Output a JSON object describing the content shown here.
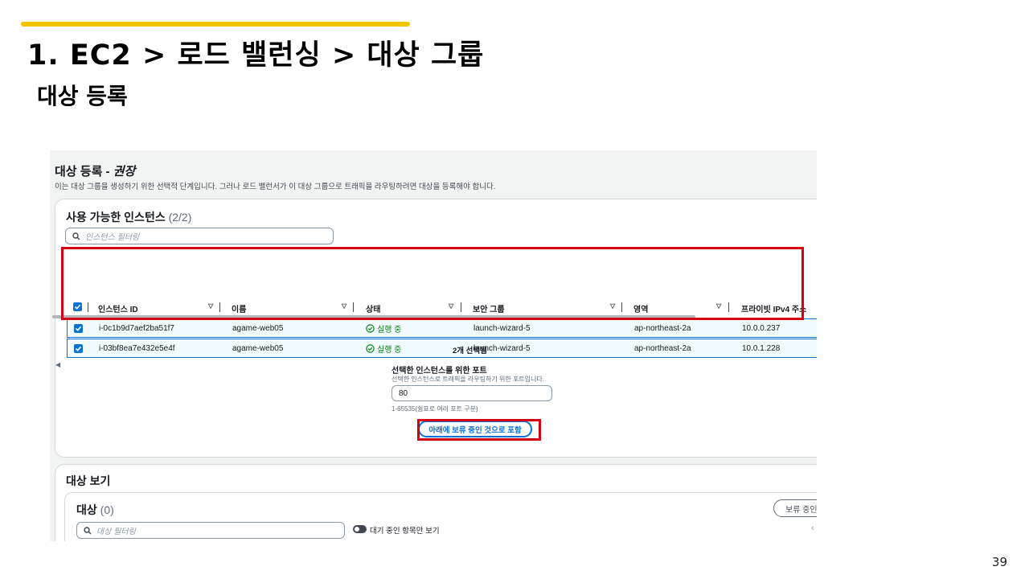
{
  "slide": {
    "title": "1. EC2 > 로드 밸런싱 > 대상 그룹",
    "subtitle": "대상 등록",
    "page_number": "39",
    "accent_color": "#f5c400",
    "highlight_color": "#d70012"
  },
  "register": {
    "heading": "대상 등록 - ",
    "heading_em": "권장",
    "description": "이는 대상 그룹을 생성하기 위한 선택적 단계입니다. 그러나 로드 밸런서가 이 대상 그룹으로 트래픽을 라우팅하려면 대상을 등록해야 합니다."
  },
  "instances": {
    "title": "사용 가능한 인스턴스",
    "count": "(2/2)",
    "search_placeholder": "인스턴스 필터링",
    "columns": [
      "인스턴스 ID",
      "이름",
      "상태",
      "보안 그룹",
      "영역",
      "프라이빗 IPv4 주소"
    ],
    "rows": [
      {
        "id": "i-0c1b9d7aef2ba51f7",
        "name": "agame-web05",
        "state": "실행 중",
        "sg": "launch-wizard-5",
        "zone": "ap-northeast-2a",
        "ip": "10.0.0.237",
        "checked": true
      },
      {
        "id": "i-03bf8ea7e432e5e4f",
        "name": "agame-web05",
        "state": "실행 중",
        "sg": "launch-wizard-5",
        "zone": "ap-northeast-2a",
        "ip": "10.0.1.228",
        "checked": true
      }
    ],
    "selected_text": "2개 선택됨",
    "port_label": "선택한 인스턴스를 위한 포트",
    "port_desc": "선택한 인스턴스로 트래픽을 라우팅하기 위한 포트입니다.",
    "port_value": "80",
    "port_hint": "1-65535(쉼표로 여러 포트 구분)",
    "include_button": "아래에 보류 중인 것으로 포함"
  },
  "targets": {
    "title": "대상 보기",
    "inner_title": "대상",
    "count": "(0)",
    "search_placeholder": "대상 필터링",
    "toggle_label": "대기 중인 항목만 보기",
    "pending_button": "보류 중인"
  }
}
